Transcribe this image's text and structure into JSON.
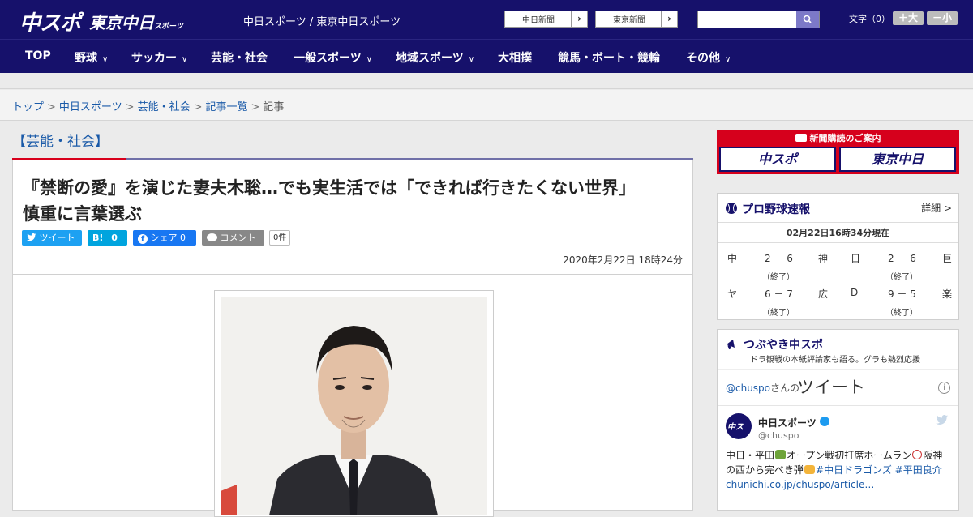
{
  "header": {
    "logo_chuspo": "中スポ",
    "logo_tokyo": "東京中日",
    "logo_tokyo_small": "スポーツ",
    "site_names": "中日スポーツ / 東京中日スポーツ",
    "link_chunichi": "中日新聞",
    "link_tokyo": "東京新聞",
    "search_placeholder": "",
    "fontsize_label": "文字（0）",
    "font_larger": "＋大",
    "font_smaller": "－小"
  },
  "nav": {
    "items": [
      {
        "label": "TOP"
      },
      {
        "label": "野球"
      },
      {
        "label": "サッカー"
      },
      {
        "label": "芸能・社会"
      },
      {
        "label": "一般スポーツ"
      },
      {
        "label": "地域スポーツ"
      },
      {
        "label": "大相撲"
      },
      {
        "label": "競馬・ボート・競輪"
      },
      {
        "label": "その他"
      }
    ]
  },
  "breadcrumb": {
    "items": [
      "トップ",
      "中日スポーツ",
      "芸能・社会",
      "記事一覧"
    ],
    "current": "記事"
  },
  "article": {
    "category": "【芸能・社会】",
    "headline_line1": "『禁断の愛』を演じた妻夫木聡…でも実生活では「できれば行きたくない世界」",
    "headline_line2": "慎重に言葉選ぶ",
    "share": {
      "tweet": "ツイート",
      "hatena_count": "0",
      "facebook": "シェア 0",
      "comment": "コメント",
      "comment_count": "0件"
    },
    "date": "2020年2月22日 18時24分"
  },
  "sidebar": {
    "ad": {
      "top_text": "新聞購読のご案内",
      "box1": "中スポ",
      "box2": "東京中日"
    },
    "scores": {
      "title": "プロ野球速報",
      "more": "詳細 >",
      "time": "02月22日16時34分現在",
      "games": [
        {
          "home": "中",
          "score": "2 － 6",
          "away": "神",
          "status": "（終了）"
        },
        {
          "home": "日",
          "score": "2 － 6",
          "away": "巨",
          "status": "（終了）"
        },
        {
          "home": "ヤ",
          "score": "6 － 7",
          "away": "広",
          "status": "（終了）"
        },
        {
          "home": "D",
          "score": "9 － 5",
          "away": "楽",
          "status": "（終了）"
        }
      ]
    },
    "tweets": {
      "title": "つぶやき中スポ",
      "subtitle": "ドラ観戦の本紙評論家も語る。グラも熱烈応援",
      "handle": "@chuspo",
      "handle_suffix": "さんの",
      "tweet_word": "ツイート",
      "author_name": "中日スポーツ",
      "author_user": "@chuspo",
      "text_1": "中日・平田",
      "text_2": "オープン戦初打席ホームラン",
      "text_3": "阪神",
      "text_4": "の西から完ぺき弾",
      "hashtags": "#中日ドラゴンズ #平田良介",
      "link": "chunichi.co.jp/chuspo/article…"
    }
  },
  "colors": {
    "header_navy": "#16116b",
    "accent_red": "#d8001c",
    "link_blue": "#1a5aa8"
  }
}
